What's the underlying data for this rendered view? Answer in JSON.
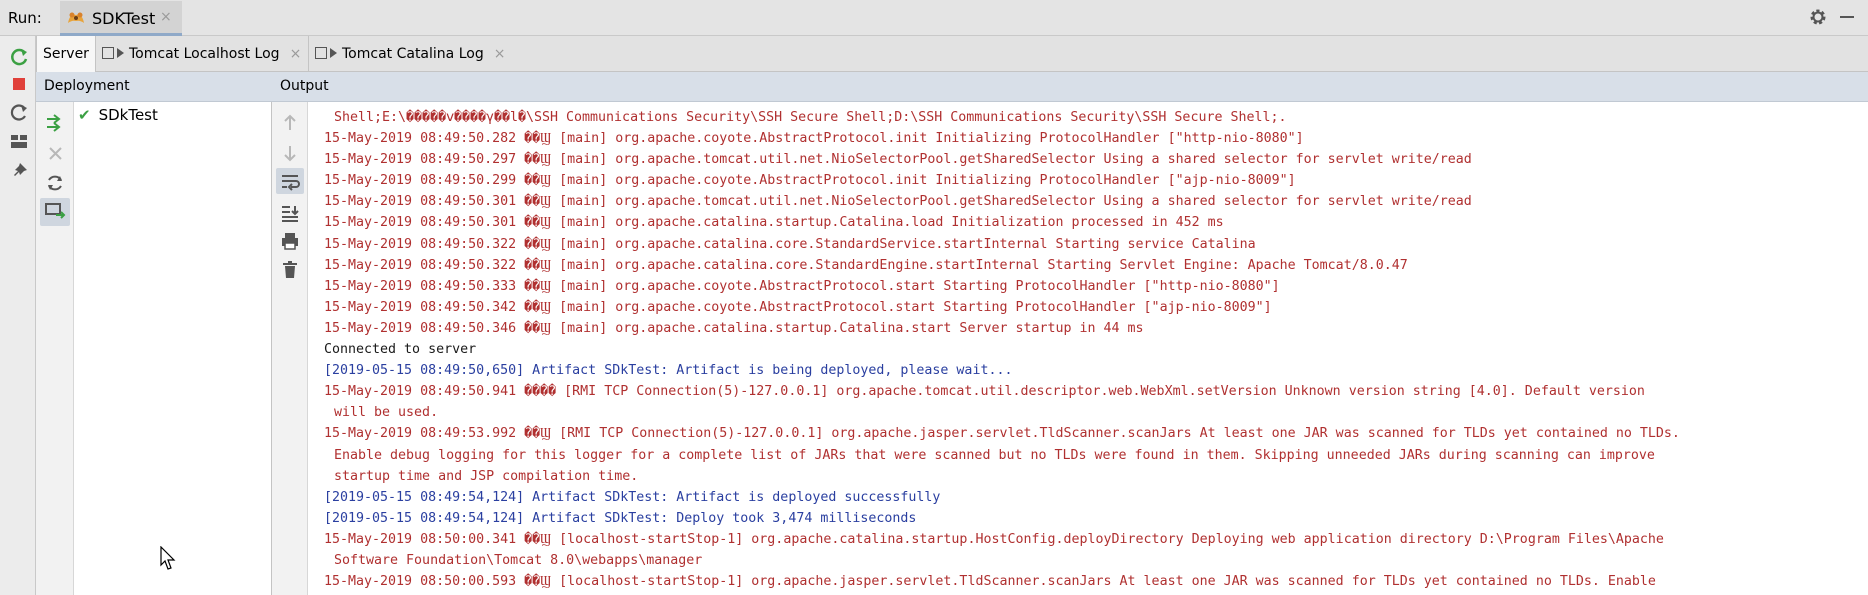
{
  "run_bar": {
    "label": "Run:",
    "tab_title": "SDKTest",
    "tab_close": "×"
  },
  "tabs": [
    {
      "label": "Server",
      "active": true
    },
    {
      "label": "Tomcat Localhost Log",
      "close": "×"
    },
    {
      "label": "Tomcat Catalina Log",
      "close": "×"
    }
  ],
  "deployment": {
    "header": "Deployment",
    "items": [
      {
        "label": "SDkTest",
        "status": "deployed"
      }
    ]
  },
  "output": {
    "header": "Output",
    "lines": [
      {
        "text": "Shell;E:\\�����ⅴ����γ��l�\\SSH Communications Security\\SSH Secure Shell;D:\\SSH Communications Security\\SSH Secure Shell;.",
        "kind": "err",
        "cont": true
      },
      {
        "text": "15-May-2019 08:49:50.282 ��Ϣ [main] org.apache.coyote.AbstractProtocol.init Initializing ProtocolHandler [\"http-nio-8080\"]",
        "kind": "err"
      },
      {
        "text": "15-May-2019 08:49:50.297 ��Ϣ [main] org.apache.tomcat.util.net.NioSelectorPool.getSharedSelector Using a shared selector for servlet write/read",
        "kind": "err"
      },
      {
        "text": "15-May-2019 08:49:50.299 ��Ϣ [main] org.apache.coyote.AbstractProtocol.init Initializing ProtocolHandler [\"ajp-nio-8009\"]",
        "kind": "err"
      },
      {
        "text": "15-May-2019 08:49:50.301 ��Ϣ [main] org.apache.tomcat.util.net.NioSelectorPool.getSharedSelector Using a shared selector for servlet write/read",
        "kind": "err"
      },
      {
        "text": "15-May-2019 08:49:50.301 ��Ϣ [main] org.apache.catalina.startup.Catalina.load Initialization processed in 452 ms",
        "kind": "err"
      },
      {
        "text": "15-May-2019 08:49:50.322 ��Ϣ [main] org.apache.catalina.core.StandardService.startInternal Starting service Catalina",
        "kind": "err"
      },
      {
        "text": "15-May-2019 08:49:50.322 ��Ϣ [main] org.apache.catalina.core.StandardEngine.startInternal Starting Servlet Engine: Apache Tomcat/8.0.47",
        "kind": "err"
      },
      {
        "text": "15-May-2019 08:49:50.333 ��Ϣ [main] org.apache.coyote.AbstractProtocol.start Starting ProtocolHandler [\"http-nio-8080\"]",
        "kind": "err"
      },
      {
        "text": "15-May-2019 08:49:50.342 ��Ϣ [main] org.apache.coyote.AbstractProtocol.start Starting ProtocolHandler [\"ajp-nio-8009\"]",
        "kind": "err"
      },
      {
        "text": "15-May-2019 08:49:50.346 ��Ϣ [main] org.apache.catalina.startup.Catalina.start Server startup in 44 ms",
        "kind": "err"
      },
      {
        "text": "Connected to server",
        "kind": "plain"
      },
      {
        "text": "[2019-05-15 08:49:50,650] Artifact SDkTest: Artifact is being deployed, please wait...",
        "kind": "info"
      },
      {
        "text": "15-May-2019 08:49:50.941 ���� [RMI TCP Connection(5)-127.0.0.1] org.apache.tomcat.util.descriptor.web.WebXml.setVersion Unknown version string [4.0]. Default version",
        "kind": "err"
      },
      {
        "text": "will be used.",
        "kind": "err",
        "cont": true
      },
      {
        "text": "15-May-2019 08:49:53.992 ��Ϣ [RMI TCP Connection(5)-127.0.0.1] org.apache.jasper.servlet.TldScanner.scanJars At least one JAR was scanned for TLDs yet contained no TLDs.",
        "kind": "err"
      },
      {
        "text": "Enable debug logging for this logger for a complete list of JARs that were scanned but no TLDs were found in them. Skipping unneeded JARs during scanning can improve",
        "kind": "err",
        "cont": true
      },
      {
        "text": "startup time and JSP compilation time.",
        "kind": "err",
        "cont": true
      },
      {
        "text": "[2019-05-15 08:49:54,124] Artifact SDkTest: Artifact is deployed successfully",
        "kind": "info"
      },
      {
        "text": "[2019-05-15 08:49:54,124] Artifact SDkTest: Deploy took 3,474 milliseconds",
        "kind": "info"
      },
      {
        "text": "15-May-2019 08:50:00.341 ��Ϣ [localhost-startStop-1] org.apache.catalina.startup.HostConfig.deployDirectory Deploying web application directory D:\\Program Files\\Apache",
        "kind": "err"
      },
      {
        "text": "Software Foundation\\Tomcat 8.0\\webapps\\manager",
        "kind": "err",
        "cont": true
      },
      {
        "text": "15-May-2019 08:50:00.593 ��Ϣ [localhost-startStop-1] org.apache.jasper.servlet.TldScanner.scanJars At least one JAR was scanned for TLDs yet contained no TLDs. Enable",
        "kind": "err"
      }
    ]
  },
  "colors": {
    "error_text": "#b03030",
    "info_text": "#2a3fa0",
    "header_bg": "#d8dfe8",
    "run_green": "#3ba043",
    "stop_red": "#e0403a"
  },
  "icons": [
    "rerun-icon",
    "stop-icon",
    "restart-icon",
    "layout-icon",
    "pin-icon",
    "deploy-icon",
    "undeploy-icon",
    "refresh-icon",
    "deploy-all-icon",
    "scroll-up-icon",
    "scroll-down-icon",
    "soft-wrap-icon",
    "scroll-to-end-icon",
    "print-icon",
    "trash-icon",
    "gear-icon",
    "minimize-icon",
    "check-icon",
    "tomcat-icon"
  ]
}
